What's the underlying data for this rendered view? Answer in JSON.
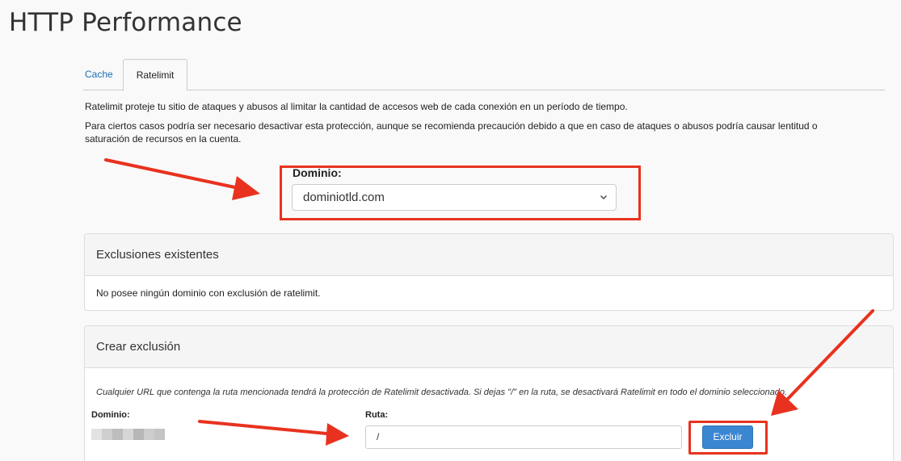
{
  "page": {
    "title": "HTTP Performance"
  },
  "tabs": [
    {
      "label": "Cache",
      "active": false
    },
    {
      "label": "Ratelimit",
      "active": true
    }
  ],
  "description": {
    "p1": "Ratelimit proteje tu sitio de ataques y abusos al limitar la cantidad de accesos web de cada conexión en un período de tiempo.",
    "p2_line1": "Para ciertos casos podría ser necesario desactivar esta protección, aunque se recomienda precaución debido a que en caso de ataques o abusos podría causar lentitud o",
    "p2_line2": "saturación de recursos en la cuenta."
  },
  "domain_selector": {
    "label": "Dominio:",
    "value": "dominiotld.com"
  },
  "existing_exclusions": {
    "title": "Exclusiones existentes",
    "empty_message": "No posee ningún dominio con exclusión de ratelimit."
  },
  "create_exclusion": {
    "title": "Crear exclusión",
    "help": "Cualquier URL que contenga la ruta mencionada tendrá la protección de Ratelimit desactivada. Si dejas \"/\" en la ruta, se desactivará Ratelimit en todo el dominio seleccionado.",
    "domain_label": "Dominio:",
    "path_label": "Ruta:",
    "path_value": "/",
    "submit_label": "Excluir"
  },
  "colors": {
    "accent": "#3b86d1",
    "link": "#1b6db3",
    "annotation": "#e8321f"
  }
}
